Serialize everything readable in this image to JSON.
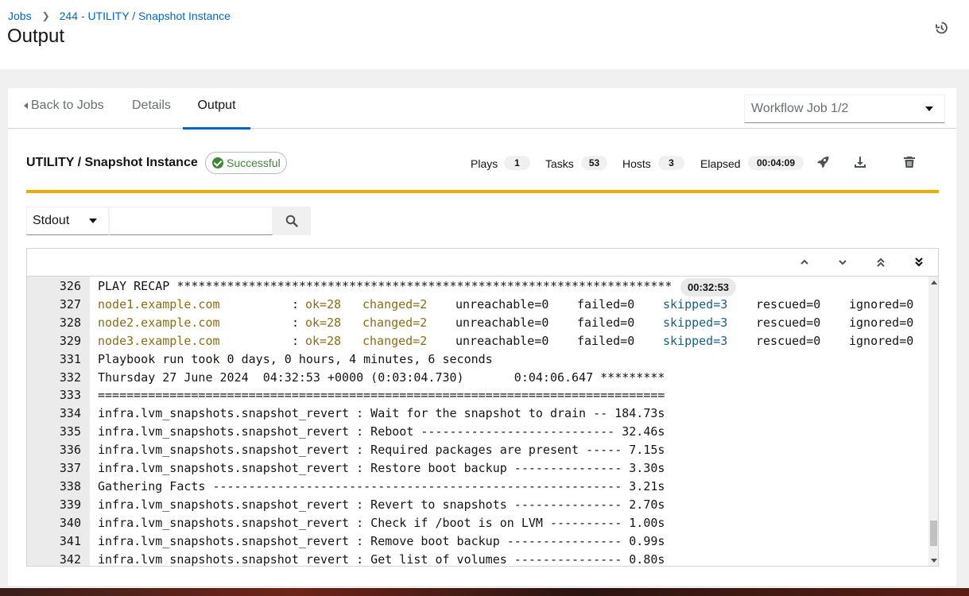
{
  "breadcrumb": {
    "root": "Jobs",
    "current": "244 - UTILITY / Snapshot Instance"
  },
  "page_title": "Output",
  "tabs": [
    {
      "label": "Back to Jobs"
    },
    {
      "label": "Details"
    },
    {
      "label": "Output"
    }
  ],
  "workflow_select": {
    "value": "Workflow Job 1/2"
  },
  "job": {
    "title": "UTILITY / Snapshot Instance",
    "status": "Successful",
    "plays_label": "Plays",
    "plays": "1",
    "tasks_label": "Tasks",
    "tasks": "53",
    "hosts_label": "Hosts",
    "hosts": "3",
    "elapsed_label": "Elapsed",
    "elapsed": "00:04:09"
  },
  "search": {
    "type": "Stdout",
    "placeholder": ""
  },
  "output": {
    "recap_time": "00:32:53",
    "lines": [
      {
        "n": "326",
        "text": "PLAY RECAP *********************************************************************"
      },
      {
        "n": "327",
        "host": "node1.example.com",
        "pad": "          : ",
        "ok": "ok=28",
        "changed": "changed=2",
        "unreachable": "unreachable=0",
        "failed": "failed=0",
        "skipped": "skipped=3",
        "rescued": "rescued=0",
        "ignored": "ignored=0"
      },
      {
        "n": "328",
        "host": "node2.example.com",
        "pad": "          : ",
        "ok": "ok=28",
        "changed": "changed=2",
        "unreachable": "unreachable=0",
        "failed": "failed=0",
        "skipped": "skipped=3",
        "rescued": "rescued=0",
        "ignored": "ignored=0"
      },
      {
        "n": "329",
        "host": "node3.example.com",
        "pad": "          : ",
        "ok": "ok=28",
        "changed": "changed=2",
        "unreachable": "unreachable=0",
        "failed": "failed=0",
        "skipped": "skipped=3",
        "rescued": "rescued=0",
        "ignored": "ignored=0"
      },
      {
        "n": "331",
        "text": "Playbook run took 0 days, 0 hours, 4 minutes, 6 seconds"
      },
      {
        "n": "332",
        "text": "Thursday 27 June 2024  04:32:53 +0000 (0:03:04.730)       0:04:06.647 *********"
      },
      {
        "n": "333",
        "text": "==============================================================================="
      },
      {
        "n": "334",
        "text": "infra.lvm_snapshots.snapshot_revert : Wait for the snapshot to drain -- 184.73s"
      },
      {
        "n": "335",
        "text": "infra.lvm_snapshots.snapshot_revert : Reboot --------------------------- 32.46s"
      },
      {
        "n": "336",
        "text": "infra.lvm_snapshots.snapshot_revert : Required packages are present ----- 7.15s"
      },
      {
        "n": "337",
        "text": "infra.lvm_snapshots.snapshot_revert : Restore boot backup --------------- 3.30s"
      },
      {
        "n": "338",
        "text": "Gathering Facts --------------------------------------------------------- 3.21s"
      },
      {
        "n": "339",
        "text": "infra.lvm_snapshots.snapshot_revert : Revert to snapshots --------------- 2.70s"
      },
      {
        "n": "340",
        "text": "infra.lvm_snapshots.snapshot_revert : Check if /boot is on LVM ---------- 1.00s"
      },
      {
        "n": "341",
        "text": "infra.lvm_snapshots.snapshot_revert : Remove boot backup ---------------- 0.99s"
      },
      {
        "n": "342",
        "text": "infra.lvm_snapshots.snapshot_revert : Get list of volumes --------------- 0.80s"
      }
    ]
  },
  "icons": {
    "history": "history-icon",
    "relaunch": "rocket-icon",
    "download": "download-icon",
    "delete": "trash-icon",
    "search": "search-icon"
  },
  "colors": {
    "accent": "#0066cc",
    "status_bar": "#f0ab00",
    "success": "#3e8635",
    "host": "#8b6d15",
    "skipped": "#195e85"
  }
}
